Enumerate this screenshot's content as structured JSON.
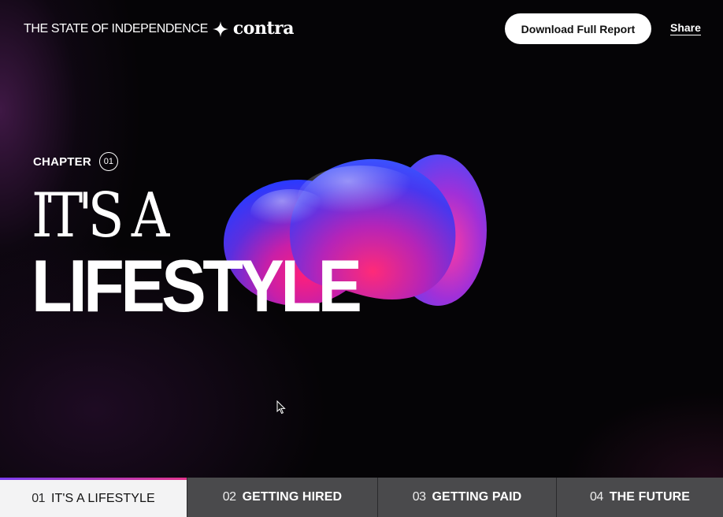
{
  "header": {
    "brand_text": "THE STATE OF INDEPENDENCE",
    "logo_text": "contra",
    "download_label": "Download Full Report",
    "share_label": "Share"
  },
  "hero": {
    "chapter_label": "CHAPTER",
    "chapter_number": "01",
    "headline_line1": "IT'S A",
    "headline_line2": "LIFESTYLE"
  },
  "chapter_nav": {
    "tabs": [
      {
        "number": "01",
        "label": "IT'S A LIFESTYLE",
        "active": true
      },
      {
        "number": "02",
        "label": "GETTING HIRED",
        "active": false
      },
      {
        "number": "03",
        "label": "GETTING PAID",
        "active": false
      },
      {
        "number": "04",
        "label": "THE FUTURE",
        "active": false
      }
    ]
  },
  "colors": {
    "background": "#050406",
    "accent_purple": "#7b3df0",
    "accent_pink": "#e2358e",
    "nav_inactive": "#4a4a4c",
    "nav_active": "#f3f3f4"
  },
  "icons": [
    "sparkle-star-icon",
    "cursor-pointer-icon"
  ]
}
